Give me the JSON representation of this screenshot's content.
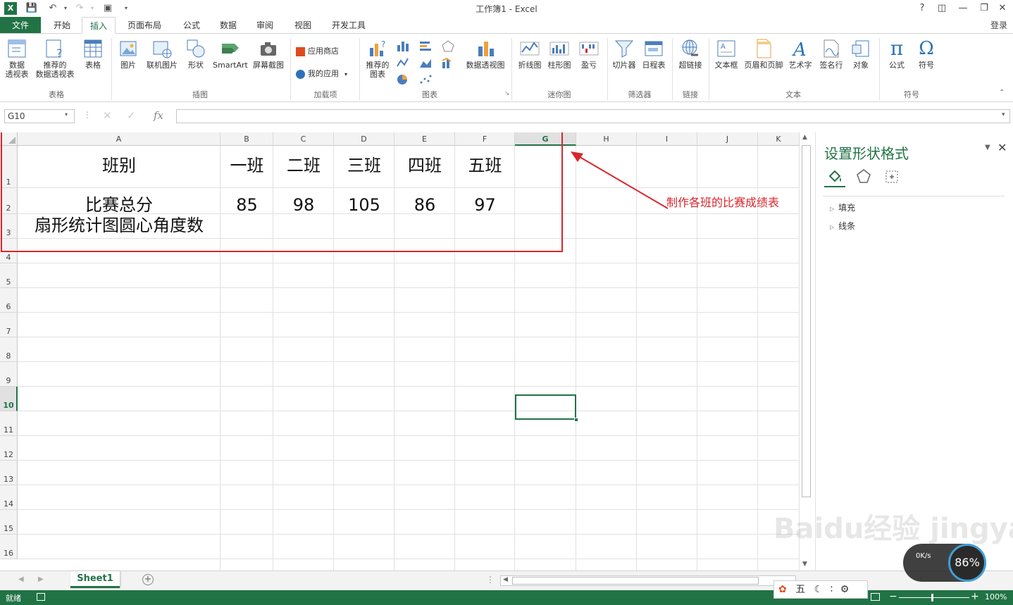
{
  "window": {
    "title": "工作簿1 - Excel",
    "help": "?",
    "login": "登录"
  },
  "tabs": [
    "文件",
    "开始",
    "插入",
    "页面布局",
    "公式",
    "数据",
    "审阅",
    "视图",
    "开发工具"
  ],
  "ribbon": {
    "tables": {
      "pivot": "数据\n透视表",
      "recommended_pivot": "推荐的\n数据透视表",
      "table": "表格",
      "group": "表格"
    },
    "illustrations": {
      "picture": "图片",
      "online_picture": "联机图片",
      "shapes": "形状",
      "smartart": "SmartArt",
      "screenshot": "屏幕截图",
      "group": "插图"
    },
    "addins": {
      "store": "应用商店",
      "my_apps": "我的应用",
      "group": "加载项"
    },
    "charts": {
      "recommended": "推荐的\n图表",
      "pivot_chart": "数据透视图",
      "group": "图表"
    },
    "sparklines": {
      "line": "折线图",
      "column": "柱形图",
      "winloss": "盈亏",
      "group": "迷你图"
    },
    "filters": {
      "slicer": "切片器",
      "timeline": "日程表",
      "group": "筛选器"
    },
    "links": {
      "hyperlink": "超链接",
      "group": "链接"
    },
    "text": {
      "textbox": "文本框",
      "header_footer": "页眉和页脚",
      "wordart": "艺术字",
      "signature": "签名行",
      "object": "对象",
      "group": "文本"
    },
    "symbols": {
      "equation": "公式",
      "symbol": "符号",
      "group": "符号"
    }
  },
  "formula_bar": {
    "name_box": "G10",
    "fx": "fx",
    "value": ""
  },
  "columns": [
    "A",
    "B",
    "C",
    "D",
    "E",
    "F",
    "G",
    "H",
    "I",
    "J",
    "K"
  ],
  "rows": [
    "1",
    "2",
    "3",
    "4",
    "5",
    "6",
    "7",
    "8",
    "9",
    "10",
    "11",
    "12",
    "13",
    "14",
    "15",
    "16"
  ],
  "cells": {
    "A1": "班别",
    "B1": "一班",
    "C1": "二班",
    "D1": "三班",
    "E1": "四班",
    "F1": "五班",
    "A2": "比赛总分",
    "B2": "85",
    "C2": "98",
    "D2": "105",
    "E2": "86",
    "F2": "97",
    "A3": "扇形统计图圆心角度数"
  },
  "annotation": {
    "text": "制作各班的比赛成绩表",
    "color": "#d9262c"
  },
  "pane": {
    "title": "设置形状格式",
    "items": [
      "填充",
      "线条"
    ]
  },
  "sheets": [
    "Sheet1"
  ],
  "status": {
    "ready": "就绪",
    "zoom": "100%",
    "ime": "五",
    "net": "0K/s",
    "cpu": "86%"
  },
  "watermark": "Baidu经验 jingyan.baidu.com",
  "colors": {
    "accent": "#217346",
    "red": "#d9262c"
  }
}
